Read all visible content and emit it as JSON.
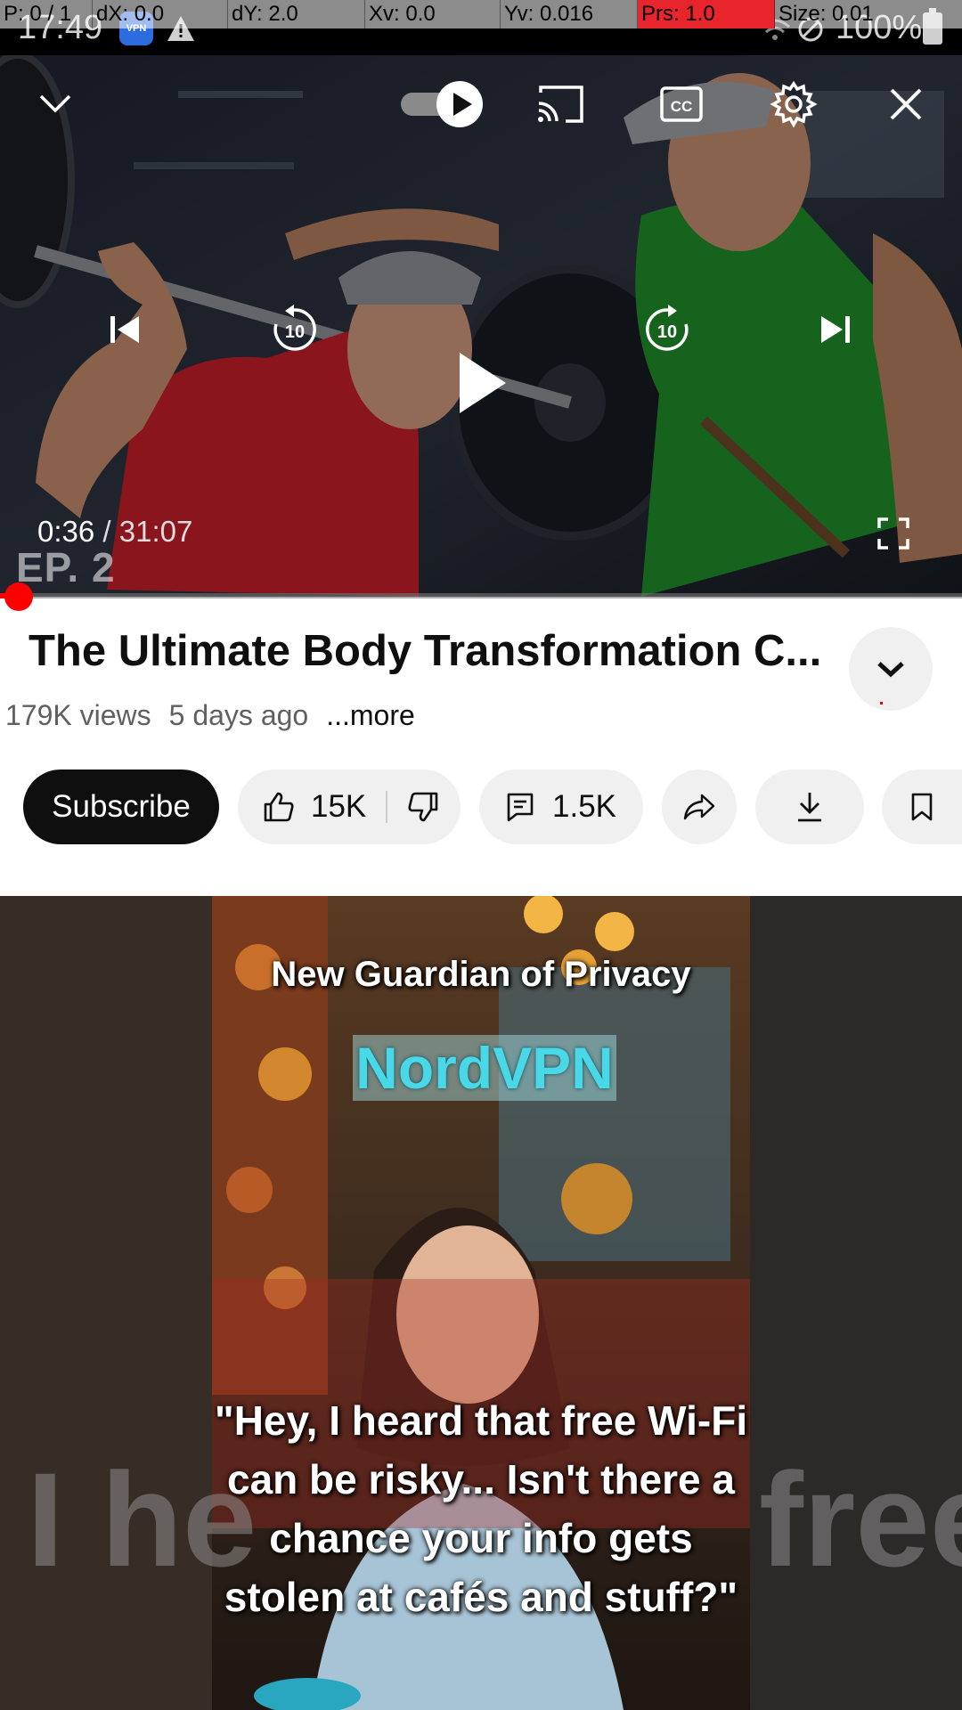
{
  "status_bar": {
    "time": "17:49",
    "vpn_badge": "VPN",
    "battery": "100%"
  },
  "debug_overlay": {
    "items": [
      "P: 0 / 1",
      "dX: 0.0",
      "dY: 2.0",
      "Xv: 0.0",
      "Yv: 0.016",
      "Prs: 1.0",
      "Size: 0.01"
    ]
  },
  "player": {
    "current_time": "0:36",
    "separator": " / ",
    "duration": "31:07",
    "overlay_text": "EP. 2",
    "progress_fraction": 0.019,
    "skip_seconds": "10",
    "icons": [
      "collapse-icon",
      "autoplay-toggle-icon",
      "cast-icon",
      "captions-icon",
      "settings-icon",
      "close-icon",
      "previous-icon",
      "rewind-10-icon",
      "play-icon",
      "forward-10-icon",
      "next-icon",
      "fullscreen-icon"
    ]
  },
  "video": {
    "title": "The Ultimate Body Transformation C...",
    "views": "179K views",
    "age": "5 days ago",
    "more_label": "...more"
  },
  "actions": {
    "subscribe": "Subscribe",
    "likes": "15K",
    "comments": "1.5K"
  },
  "feed_item": {
    "headline": "New Guardian of Privacy",
    "brand": "NordVPN",
    "quote": "\"Hey, I heard that free Wi-Fi can be risky... Isn't there a chance your info gets stolen at cafés and stuff?\"",
    "background_left": "I he",
    "background_right": "free"
  },
  "colors": {
    "accent_red": "#ff0000",
    "text_primary": "#0f0f0f",
    "text_secondary": "#606060",
    "chip_bg": "#f0f0f0"
  }
}
